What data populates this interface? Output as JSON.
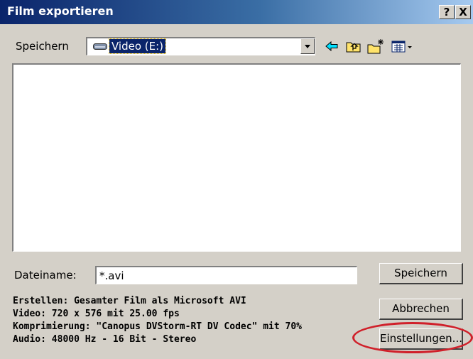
{
  "window": {
    "title": "Film exportieren",
    "help_label": "?",
    "close_label": "X"
  },
  "location": {
    "label": "Speichern",
    "selected": "Video (E:)",
    "icon": "drive-icon"
  },
  "toolbar": {
    "icons": [
      "back-arrow-icon",
      "up-folder-icon",
      "new-folder-icon",
      "view-menu-icon"
    ]
  },
  "file_list": {
    "items": []
  },
  "filename": {
    "label": "Dateiname:",
    "value": "*.avi"
  },
  "buttons": {
    "save": "Speichern",
    "cancel": "Abbrechen",
    "settings": "Einstellungen..."
  },
  "info": {
    "line1": "Erstellen: Gesamter Film als Microsoft AVI",
    "line2": "Video: 720 x 576 mit 25.00 fps",
    "line3": "Komprimierung: \"Canopus DVStorm-RT DV Codec\" mit 70%",
    "line4": "Audio: 48000 Hz - 16 Bit - Stereo"
  },
  "colors": {
    "title_bar_start": "#0a246a",
    "title_bar_end": "#a6caf0",
    "annotation_ring": "#d0202a"
  }
}
